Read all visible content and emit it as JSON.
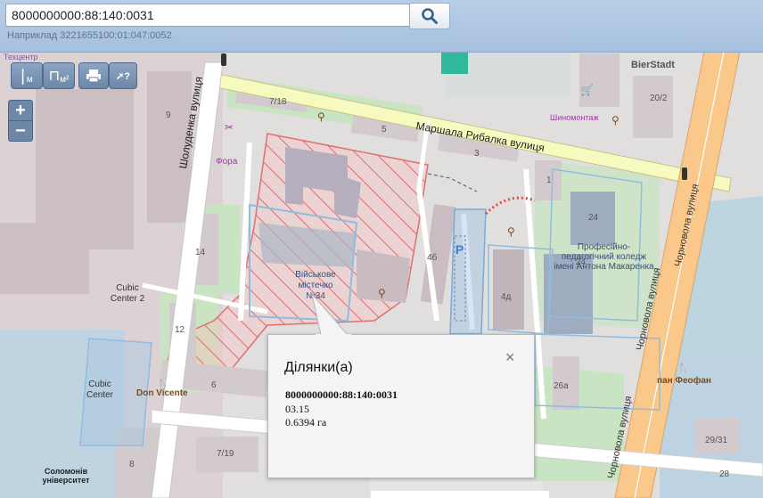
{
  "search": {
    "value": "8000000000:88:140:0031",
    "hint": "Наприклад 3221655100:01:047:0052"
  },
  "tools": {
    "measure_length_label": "м",
    "measure_area_label": "м²"
  },
  "zoom": {
    "in": "+",
    "out": "−"
  },
  "map_labels": {
    "street_rybalka": "Маршала Рибалка вулиця",
    "street_sholudenka": "Шолуденка вулиця",
    "street_chornovola_1": "Чорновола вулиця",
    "street_chornovola_2": "Чорновола вулиця",
    "street_chornovola_3": "Чорновола вулиця",
    "texcentr": "Техцентр",
    "bierstadt": "BierStadt",
    "shynomontazh": "Шиномонтаж",
    "fora": "Фора",
    "cubic_center_2": "Cubic Center 2",
    "cubic_center": "Cubic Center",
    "don_vicente": "Don Vicente",
    "solomon_univ": "Соломонів університет",
    "pan_feofan": "пан Феофан",
    "military_town": "Військове містечко №34",
    "college": "Професійно-педагогічний коледж імені Антона Макаренка",
    "parking": "P",
    "h9": "9",
    "h718": "7/18",
    "h5": "5",
    "h3": "3",
    "h1": "1",
    "h202": "20/2",
    "h14": "14",
    "h12": "12",
    "h6": "6",
    "h4b": "4б",
    "h4d": "4д",
    "h24a": "24",
    "h24b": "24",
    "h26a": "26а",
    "h2931": "29/31",
    "h28": "28",
    "h719": "7/19",
    "h8": "8"
  },
  "popup": {
    "title": "Ділянки(а)",
    "cadastral": "8000000000:88:140:0031",
    "code": "03.15",
    "area": "0.6394 га",
    "close": "×"
  }
}
